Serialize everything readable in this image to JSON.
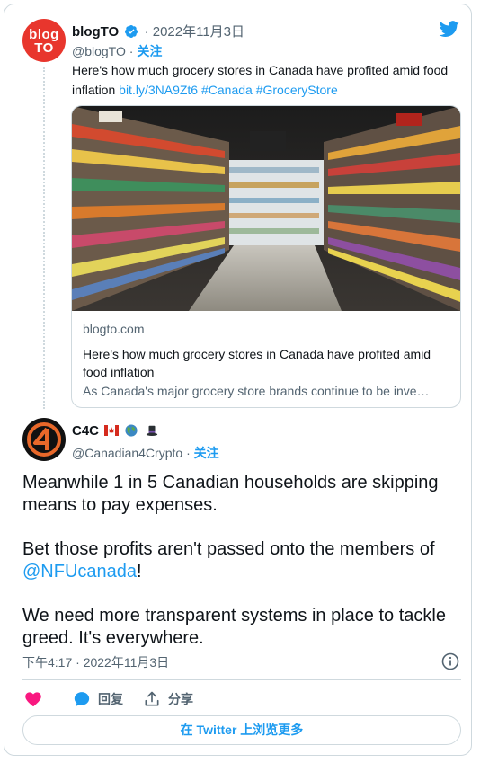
{
  "quoted": {
    "avatar_line1": "blog",
    "avatar_line2": "TO",
    "name": "blogTO",
    "date": "· 2022年11月3日",
    "handle": "@blogTO",
    "follow": "关注",
    "text": "Here's how much grocery stores in Canada have profited amid food inflation ",
    "link": "bit.ly/3NA9Zt6",
    "hashtag1": "#Canada",
    "hashtag2": "#GroceryStore",
    "card": {
      "domain": "blogto.com",
      "title": "Here's how much grocery stores in Canada have profited amid food inflation",
      "description": "As Canada's major grocery store brands continue to be inve…"
    }
  },
  "tweet": {
    "name": "C4C",
    "handle": "@Canadian4Crypto",
    "follow": "关注",
    "para1": "Meanwhile 1 in 5 Canadian households are skipping means to pay expenses.",
    "para2_prefix": "Bet those profits aren't passed onto the members of ",
    "para2_mention": "@NFUcanada",
    "para2_suffix": "!",
    "para3": "We need more transparent systems in place to tackle greed. It's everywhere.",
    "time": "下午4:17 · 2022年11月3日"
  },
  "actions": {
    "reply_label": "回复",
    "share_label": "分享"
  },
  "view_more": "在 Twitter 上浏览更多",
  "colors": {
    "accent": "#1d9bf0",
    "like": "#f91880",
    "blogto_red": "#e8362d"
  }
}
